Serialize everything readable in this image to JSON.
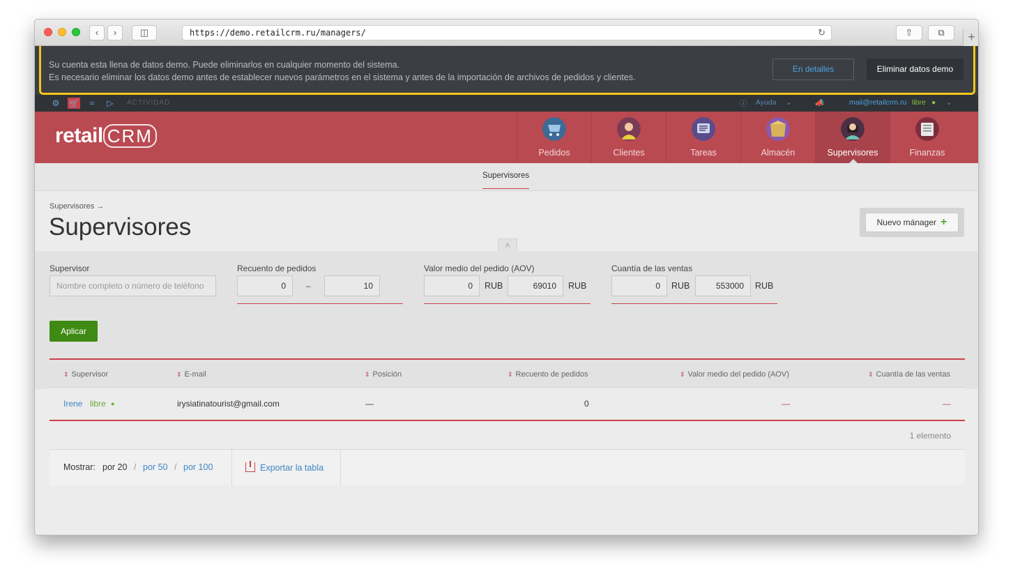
{
  "browser": {
    "url": "https://demo.retailcrm.ru/managers/"
  },
  "banner": {
    "line1": "Su cuenta esta llena de datos demo. Puede eliminarlos en cualquier momento del sistema.",
    "line2": "Es necesario eliminar los datos demo antes de establecer nuevos parámetros en el sistema y antes de la importación de archivos de pedidos y clientes.",
    "details_label": "En detalles",
    "delete_label": "Eliminar datos demo"
  },
  "topstrip": {
    "activity_label": "ACTIVIDAD",
    "help_label": "Ayuda",
    "user_email": "mail@retailcrm.ru",
    "user_status": "libre"
  },
  "header": {
    "logo_text": "retail",
    "logo_crm": "CRM",
    "nav": [
      {
        "label": "Pedidos",
        "icon": "cart-icon"
      },
      {
        "label": "Clientes",
        "icon": "client-avatar-icon"
      },
      {
        "label": "Tareas",
        "icon": "tasks-icon"
      },
      {
        "label": "Almacén",
        "icon": "warehouse-box-icon"
      },
      {
        "label": "Supervisores",
        "icon": "supervisor-avatar-icon"
      },
      {
        "label": "Finanzas",
        "icon": "finance-icon"
      }
    ]
  },
  "subnav": {
    "active": "Supervisores"
  },
  "page": {
    "breadcrumb": "Supervisores →",
    "title": "Supervisores",
    "new_button": "Nuevo mánager",
    "new_button_plus": "+"
  },
  "filters": {
    "supervisor_label": "Supervisor",
    "supervisor_placeholder": "Nombre completo o número de teléfono",
    "orders_label": "Recuento de pedidos",
    "orders_from": "0",
    "orders_to": "10",
    "range_dash": "–",
    "aov_label": "Valor medio del pedido (AOV)",
    "aov_from": "0",
    "aov_to": "69010",
    "sales_label": "Cuantía de las ventas",
    "sales_from": "0",
    "sales_to": "553000",
    "unit_rub_symbol": "RUB",
    "unit_rub": "RUB",
    "apply_label": "Aplicar"
  },
  "table": {
    "columns": [
      "Supervisor",
      "E-mail",
      "Posición",
      "Recuento de pedidos",
      "Valor medio del pedido (AOV)",
      "Cuantía de las ventas"
    ],
    "rows": [
      {
        "name": "Irene",
        "status": "libre",
        "email": "irysiatinatourist@gmail.com",
        "position": "—",
        "orders": "0",
        "aov": "—",
        "sales": "—"
      }
    ],
    "count_text": "1 elemento"
  },
  "footer": {
    "show_label": "Mostrar:",
    "page_sizes": [
      "por 20",
      "por 50",
      "por 100"
    ],
    "slash": "/",
    "export_label": "Exportar la tabla"
  }
}
